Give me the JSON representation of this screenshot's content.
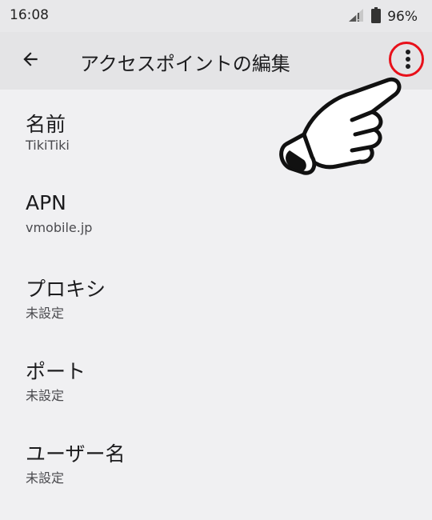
{
  "status_bar": {
    "time": "16:08",
    "battery": "96%"
  },
  "app_bar": {
    "title": "アクセスポイントの編集",
    "back_icon": "arrow-left-icon",
    "menu_icon": "more-vert-icon"
  },
  "colors": {
    "highlight": "#e8101a",
    "background": "#f0f0f2",
    "app_bar": "#e4e4e6"
  },
  "settings": [
    {
      "title": "名前",
      "value": "TikiTiki"
    },
    {
      "title": "APN",
      "value": "vmobile.jp"
    },
    {
      "title": "プロキシ",
      "value": "未設定"
    },
    {
      "title": "ポート",
      "value": "未設定"
    },
    {
      "title": "ユーザー名",
      "value": "未設定"
    }
  ]
}
